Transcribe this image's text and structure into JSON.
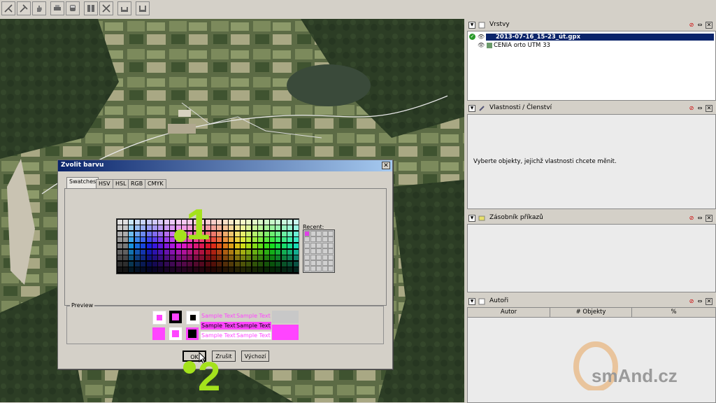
{
  "toolbar": {
    "buttons": [
      "select-tool-icon",
      "measure-tool-icon",
      "pan-hand-icon",
      "print-icon",
      "vehicle-icon",
      "layer-properties-icon",
      "delete-cross-icon",
      "export-icon",
      "import-icon"
    ]
  },
  "panels": {
    "layers": {
      "title": "Vrstvy",
      "items": [
        "2013-07-16_15-23_út.gpx",
        "CENIA orto UTM 33"
      ]
    },
    "properties": {
      "title": "Vlastnosti / Členství",
      "message": "Vyberte objekty, jejichž vlastnosti chcete měnit."
    },
    "commands": {
      "title": "Zásobník příkazů"
    },
    "authors": {
      "title": "Autoři",
      "columns": [
        "Autor",
        "# Objekty",
        "%"
      ]
    }
  },
  "dialog": {
    "title": "Zvolit barvu",
    "close_glyph": "✕",
    "tabs": [
      "Swatches",
      "HSV",
      "HSL",
      "RGB",
      "CMYK"
    ],
    "active_tab": "Swatches",
    "recent_label": "Recent:",
    "recent_color": "#e040e8",
    "preview_label": "Preview",
    "sample_text": "Sample Text",
    "selected_color": "#ff44ff",
    "buttons": {
      "ok": "OK",
      "cancel": "Zrušit",
      "default": "Výchozí"
    }
  },
  "annotations": {
    "step1": "1",
    "step2": "2",
    "accent": "#a4e21c"
  },
  "watermark": {
    "text": "smAnd.cz"
  }
}
